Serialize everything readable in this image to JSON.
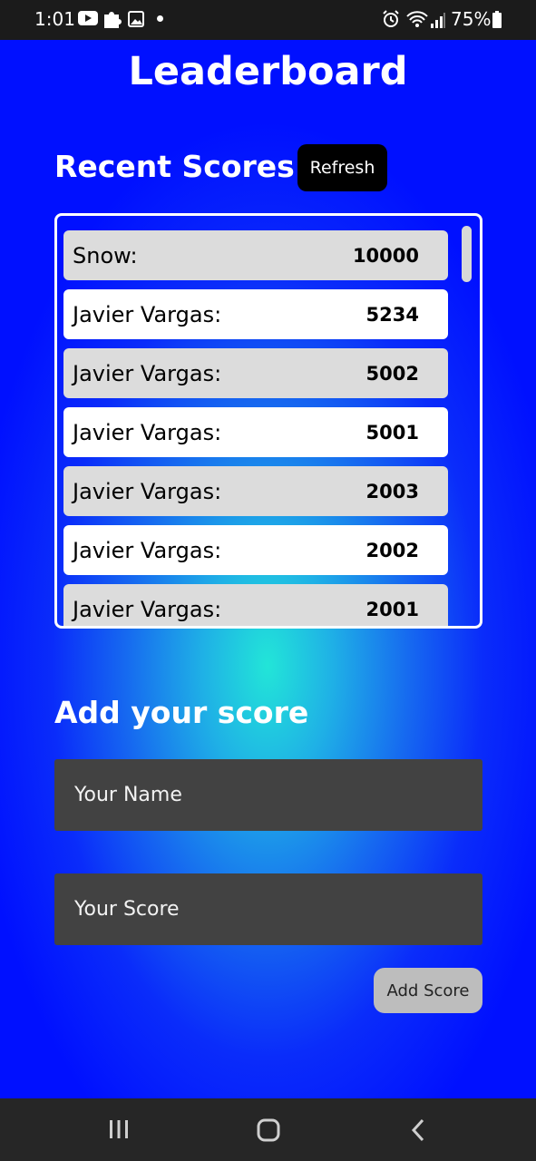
{
  "status_bar": {
    "time": "1:01",
    "battery": "75%",
    "icons": [
      "youtube-icon",
      "puzzle-icon",
      "gallery-icon",
      "notification-dot-icon",
      "alarm-icon",
      "wifi-icon",
      "signal-icon",
      "battery-icon"
    ]
  },
  "header": {
    "title": "Leaderboard"
  },
  "recent": {
    "title": "Recent Scores",
    "refresh_label": "Refresh",
    "scores": [
      {
        "name": "Snow:",
        "score": "10000"
      },
      {
        "name": "Javier Vargas:",
        "score": "5234"
      },
      {
        "name": "Javier Vargas:",
        "score": "5002"
      },
      {
        "name": "Javier Vargas:",
        "score": "5001"
      },
      {
        "name": "Javier Vargas:",
        "score": "2003"
      },
      {
        "name": "Javier Vargas:",
        "score": "2002"
      },
      {
        "name": "Javier Vargas:",
        "score": "2001"
      }
    ]
  },
  "add": {
    "title": "Add your score",
    "name_placeholder": "Your Name",
    "score_placeholder": "Your Score",
    "button_label": "Add Score"
  },
  "nav_bar": {
    "icons": [
      "recents-icon",
      "home-icon",
      "back-icon"
    ]
  },
  "colors": {
    "background": "#0012ff",
    "glow": "#22e5d8",
    "row_alt": "#dcdcdc",
    "input_bg": "#424242",
    "refresh_bg": "#000000",
    "add_button_bg": "#bdbdbd"
  }
}
